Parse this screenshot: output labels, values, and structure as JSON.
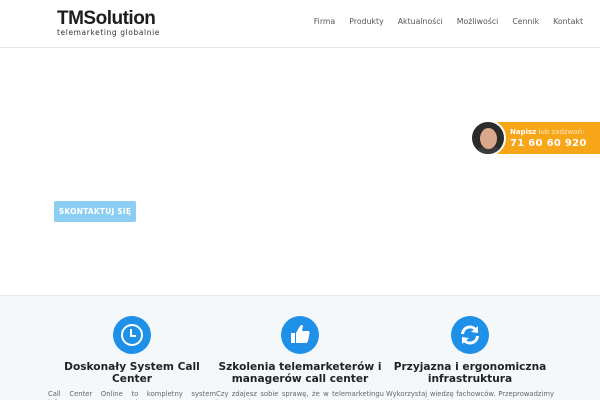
{
  "header": {
    "logo_main": "TMSolution",
    "logo_sub": "telemarketing globalnie",
    "nav": [
      "Firma",
      "Produkty",
      "Aktualności",
      "Możliwości",
      "Cennik",
      "Kontakt"
    ]
  },
  "hero": {
    "cta_label": "SKONTAKTUJ SIĘ"
  },
  "contact_widget": {
    "prefix_bold": "Napisz",
    "prefix_rest": " lub zadzwoń:",
    "phone": "71 60 60 920"
  },
  "features": [
    {
      "icon": "clock-icon",
      "title": "Doskonały System Call Center",
      "desc": "Call Center Online to kompletny system informatyczny wspomagający prace"
    },
    {
      "icon": "thumbs-up-icon",
      "title": "Szkolenia telemarketerów i managerów call center",
      "desc": "Czy zdajesz sobie sprawę, że w telemarketingu koszty związane z"
    },
    {
      "icon": "refresh-icon",
      "title": "Przyjazna i ergonomiczna infrastruktura",
      "desc": "Wykorzystaj wiedzę fachowców. Przeprowadzimy Cię przez cały proces"
    }
  ],
  "colors": {
    "accent_blue": "#1e90e8",
    "cta_blue": "#8ccdf2",
    "widget_orange": "#f7a618"
  }
}
